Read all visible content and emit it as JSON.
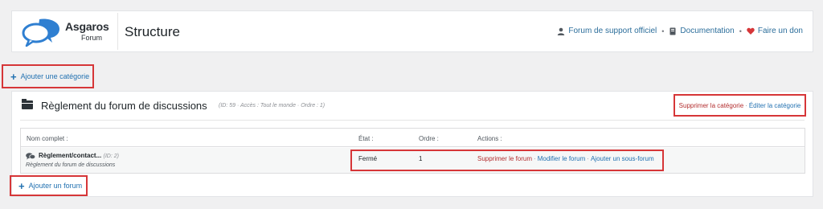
{
  "header": {
    "logo_word": "Asgaros",
    "logo_sub": "Forum",
    "page_title": "Structure",
    "links": [
      {
        "label": "Forum de support officiel",
        "icon": "user-icon"
      },
      {
        "label": "Documentation",
        "icon": "book-icon"
      },
      {
        "label": "Faire un don",
        "icon": "heart-icon"
      }
    ],
    "separator": "•"
  },
  "add_category_label": "Ajouter une catégorie",
  "category": {
    "name": "Règlement du forum de discussions",
    "meta": "(ID: 59 · Accès : Tout le monde · Ordre : 1)",
    "delete_label": "Supprimer la catégorie",
    "edit_label": "Éditer la catégorie",
    "separator": "·"
  },
  "table": {
    "headers": {
      "name": "Nom complet :",
      "state": "État :",
      "order": "Ordre :",
      "actions": "Actions :"
    },
    "rows": [
      {
        "name": "Règlement/contact...",
        "id_text": "(ID: 2)",
        "description": "Règlement du forum de discussions",
        "state": "Fermé",
        "order": "1",
        "delete_label": "Supprimer le forum",
        "edit_label": "Modifier le forum",
        "add_sub_label": "Ajouter un sous-forum"
      }
    ]
  },
  "add_forum_label": "Ajouter un forum",
  "colors": {
    "link": "#2271b1",
    "danger": "#b32d2e",
    "highlight_border": "#d63638",
    "heart": "#d63638"
  }
}
